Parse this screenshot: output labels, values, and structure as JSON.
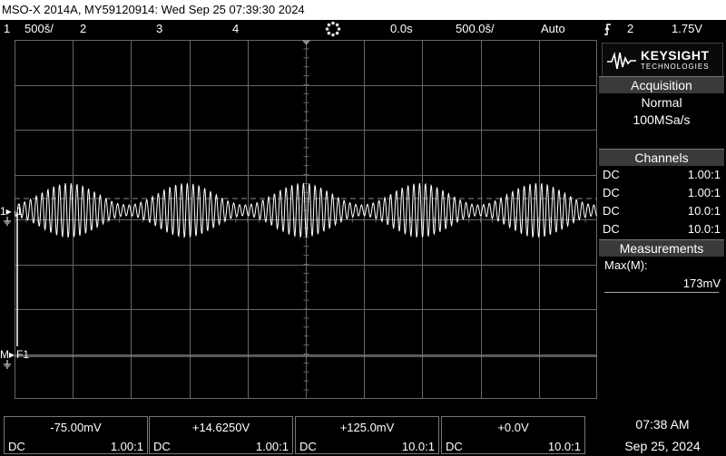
{
  "titlebar": {
    "text": "MSO-X 2014A, MY59120914: Wed Sep 25 07:39:30 2024"
  },
  "status": {
    "ch1_num": "1",
    "ch1_scale": "500š/",
    "ch2_num": "2",
    "ch3_num": "3",
    "ch4_num": "4",
    "delay": "0.0s",
    "timebase": "500.0š/",
    "trigger_mode": "Auto",
    "trigger_source": "2",
    "trigger_level": "1.75V"
  },
  "markers": {
    "ch1": "1",
    "ch1_arrow": "1▸",
    "math": "M▸",
    "math_label": "F1"
  },
  "logo": {
    "line1": "KEYSIGHT",
    "line2": "TECHNOLOGIES"
  },
  "acquisition": {
    "title": "Acquisition",
    "mode": "Normal",
    "rate": "100MSa/s"
  },
  "channels": {
    "title": "Channels",
    "rows": [
      {
        "coupling": "DC",
        "ratio": "1.00:1"
      },
      {
        "coupling": "DC",
        "ratio": "1.00:1"
      },
      {
        "coupling": "DC",
        "ratio": "10.0:1"
      },
      {
        "coupling": "DC",
        "ratio": "10.0:1"
      }
    ]
  },
  "measurements": {
    "title": "Measurements",
    "label": "Max(M):",
    "value": "173mV"
  },
  "bottom": [
    {
      "value": "-75.00mV",
      "coupling": "DC",
      "ratio": "1.00:1"
    },
    {
      "value": "+14.6250V",
      "coupling": "DC",
      "ratio": "1.00:1"
    },
    {
      "value": "+125.0mV",
      "coupling": "DC",
      "ratio": "10.0:1"
    },
    {
      "value": "+0.0V",
      "coupling": "DC",
      "ratio": "10.0:1"
    }
  ],
  "clock": {
    "time": "07:38 AM",
    "date": "Sep 25, 2024"
  },
  "colors": {
    "trace": "#ffffff",
    "grid": "#666666",
    "panel_header": "#3a3a3a",
    "background": "#000000"
  }
}
